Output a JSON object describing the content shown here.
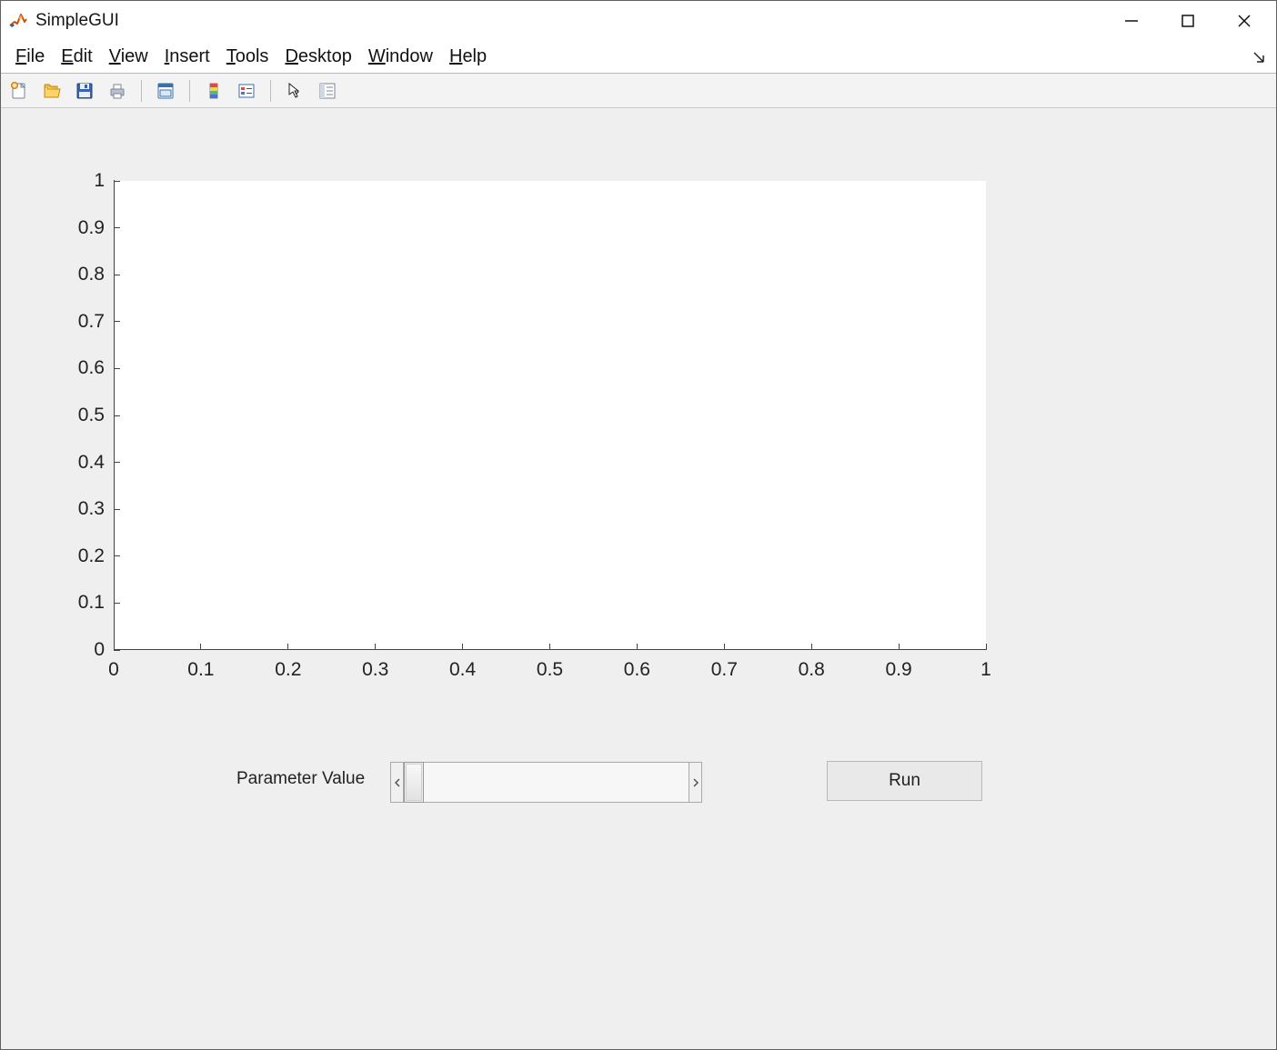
{
  "window": {
    "title": "SimpleGUI"
  },
  "menus": {
    "file": "File",
    "edit": "Edit",
    "view": "View",
    "insert": "Insert",
    "tools": "Tools",
    "desktop": "Desktop",
    "window": "Window",
    "help": "Help"
  },
  "toolbar_icons": {
    "new": "new-file-icon",
    "open": "open-folder-icon",
    "save": "save-icon",
    "print": "print-icon",
    "link": "link-icon",
    "colorbar": "colorbar-icon",
    "legend": "legend-icon",
    "pointer": "pointer-icon",
    "inspector": "inspector-icon"
  },
  "controls": {
    "param_label": "Parameter Value",
    "run_label": "Run"
  },
  "chart_data": {
    "type": "line",
    "title": "",
    "xlabel": "",
    "ylabel": "",
    "xlim": [
      0,
      1
    ],
    "ylim": [
      0,
      1
    ],
    "xticks": [
      0,
      0.1,
      0.2,
      0.3,
      0.4,
      0.5,
      0.6,
      0.7,
      0.8,
      0.9,
      1
    ],
    "yticks": [
      0,
      0.1,
      0.2,
      0.3,
      0.4,
      0.5,
      0.6,
      0.7,
      0.8,
      0.9,
      1
    ],
    "xtick_labels": [
      "0",
      "0.1",
      "0.2",
      "0.3",
      "0.4",
      "0.5",
      "0.6",
      "0.7",
      "0.8",
      "0.9",
      "1"
    ],
    "ytick_labels": [
      "0",
      "0.1",
      "0.2",
      "0.3",
      "0.4",
      "0.5",
      "0.6",
      "0.7",
      "0.8",
      "0.9",
      "1"
    ],
    "series": []
  }
}
